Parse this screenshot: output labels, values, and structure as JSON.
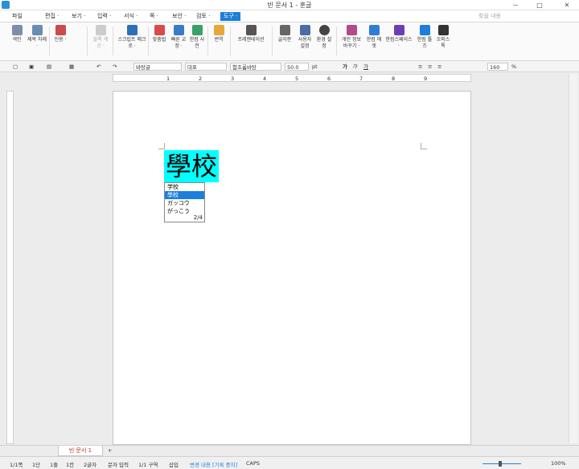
{
  "window": {
    "title": "빈 문서 1 - 훈글",
    "minimize": "－",
    "restore": "□",
    "close": "✕"
  },
  "menu": {
    "items": [
      "파일",
      "편집 ·",
      "보기 ·",
      "입력 ·",
      "서식 ·",
      "쪽 ·",
      "보안 ·",
      "검토 ·",
      "도구 ·"
    ],
    "active_index": 8,
    "search_placeholder": "찾을 내용"
  },
  "ribbon": {
    "buttons": [
      {
        "label": "색인",
        "icon": "index-icon"
      },
      {
        "label": "제목 차례 ·",
        "icon": "toc-icon"
      },
      {
        "label": "인용 ·",
        "icon": "citation-icon"
      },
      {
        "label": "블록 계산 ·",
        "icon": "block-calc-icon"
      },
      {
        "label": "스크립트 매크로 ·",
        "icon": "script-macro-icon"
      },
      {
        "label": "맞춤법",
        "icon": "spellcheck-icon"
      },
      {
        "label": "빠른 교정 ·",
        "icon": "quick-correct-icon"
      },
      {
        "label": "한컴 사전",
        "icon": "dictionary-icon"
      },
      {
        "label": "번역",
        "icon": "translate-icon"
      },
      {
        "label": "프레젠테이션",
        "icon": "presentation-icon"
      },
      {
        "label": "글자판",
        "icon": "keyboard-icon"
      },
      {
        "label": "사용자 설정",
        "icon": "user-settings-icon"
      },
      {
        "label": "환경 설정",
        "icon": "gear-icon"
      },
      {
        "label": "개인 정보 바꾸기 ·",
        "icon": "privacy-icon"
      },
      {
        "label": "한컴 애셋",
        "icon": "asset-icon"
      },
      {
        "label": "한컴스페이스 ·",
        "icon": "cloud-icon"
      },
      {
        "label": "한컴 툴즈",
        "icon": "tools-icon"
      },
      {
        "label": "오피스 톡",
        "icon": "talk-icon"
      }
    ]
  },
  "format_bar": {
    "style": "바탕글",
    "lang": "대표",
    "font": "함초롬바탕",
    "size": "50.0",
    "size_unit": "pt",
    "bold": "가",
    "italic": "가",
    "underline": "가",
    "zoom": "160",
    "zoom_unit": "%"
  },
  "ruler_marks": [
    "1",
    "2",
    "3",
    "4",
    "5",
    "6",
    "7",
    "8",
    "9"
  ],
  "document": {
    "selected_text": "學校"
  },
  "candidates": {
    "items": [
      "学校",
      "學校",
      "ガッコウ",
      "がっこう"
    ],
    "selected_index": 1,
    "page": "2/4"
  },
  "tabs": {
    "doc": "빈 문서 1",
    "add": "+"
  },
  "status": {
    "page": "1/1쪽",
    "section": "1단",
    "line": "1줄",
    "col": "1칸",
    "chars": "2글자",
    "input_mode": "문자 입력",
    "zone": "1/1 구역",
    "insert": "삽입",
    "track": "변경 내용 [기록 중지]",
    "caps": "CAPS",
    "zoom": "100%"
  }
}
